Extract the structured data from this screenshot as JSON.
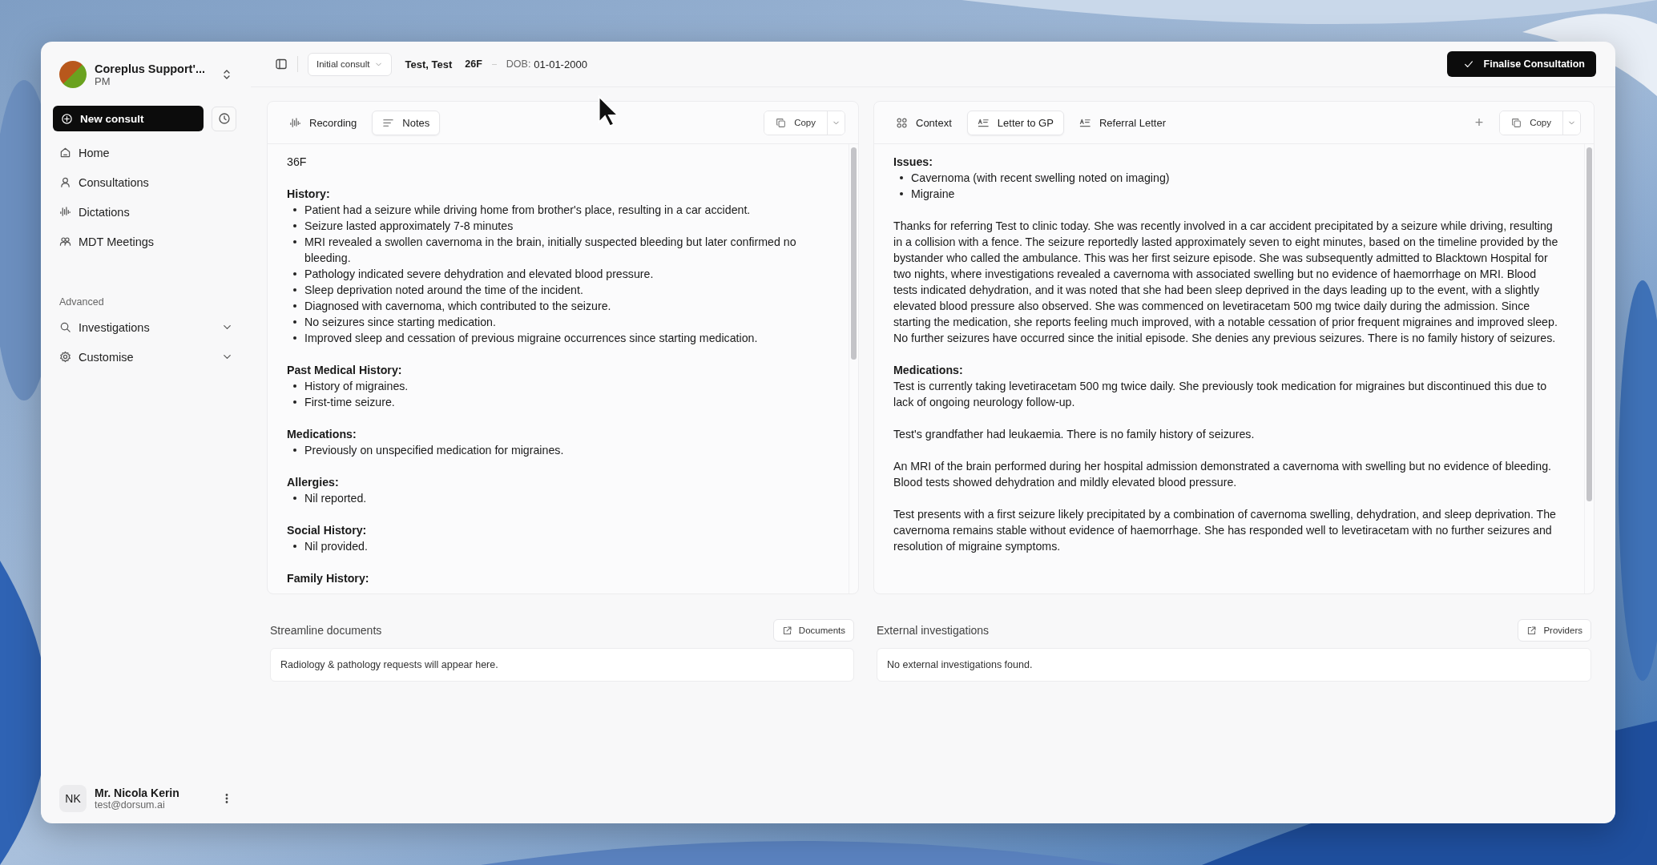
{
  "sidebar": {
    "org": {
      "name": "Coreplus Support'...",
      "role": "PM"
    },
    "new_consult": "New consult",
    "nav": [
      {
        "label": "Home"
      },
      {
        "label": "Consultations"
      },
      {
        "label": "Dictations"
      },
      {
        "label": "MDT Meetings"
      }
    ],
    "section_label": "Advanced",
    "advanced": [
      {
        "label": "Investigations",
        "expanded": false
      },
      {
        "label": "Customise",
        "expanded": false
      }
    ],
    "user": {
      "initials": "NK",
      "name": "Mr. Nicola Kerin",
      "email": "test@dorsum.ai"
    }
  },
  "header": {
    "visit_type": "Initial consult",
    "patient": "Test, Test",
    "age_sex": "26F",
    "dob_label": "DOB:",
    "dob": "01-01-2000",
    "action": "Finalise Consultation"
  },
  "panels": [
    {
      "tabs": [
        {
          "label": "Recording",
          "selected": false
        },
        {
          "label": "Notes",
          "selected": true
        }
      ],
      "copy": "Copy",
      "content": [
        {
          "kind": "text",
          "text": "36F"
        },
        {
          "kind": "heading",
          "text": "History:"
        },
        {
          "kind": "list",
          "items": [
            "Patient had a seizure while driving home from brother's place, resulting in a car accident.",
            "Seizure lasted approximately 7-8 minutes",
            "MRI revealed a swollen cavernoma in the brain, initially suspected bleeding but later confirmed no bleeding.",
            "Pathology indicated severe dehydration and elevated blood pressure.",
            "Sleep deprivation noted around the time of the incident.",
            "Diagnosed with cavernoma, which contributed to the seizure.",
            "No seizures since starting medication.",
            "Improved sleep and cessation of previous migraine occurrences since starting medication."
          ]
        },
        {
          "kind": "heading",
          "text": "Past Medical History:"
        },
        {
          "kind": "list",
          "items": [
            "History of migraines.",
            "First-time seizure."
          ]
        },
        {
          "kind": "heading",
          "text": "Medications:"
        },
        {
          "kind": "list",
          "items": [
            "Previously on unspecified medication for migraines."
          ]
        },
        {
          "kind": "heading",
          "text": "Allergies:"
        },
        {
          "kind": "list",
          "items": [
            "Nil reported."
          ]
        },
        {
          "kind": "heading",
          "text": "Social History:"
        },
        {
          "kind": "list",
          "items": [
            "Nil provided."
          ]
        },
        {
          "kind": "heading",
          "text": "Family History:"
        }
      ]
    },
    {
      "tabs": [
        {
          "label": "Context",
          "selected": false
        },
        {
          "label": "Letter to GP",
          "selected": true
        },
        {
          "label": "Referral Letter",
          "selected": false
        }
      ],
      "add": "+",
      "copy": "Copy",
      "content": [
        {
          "kind": "heading",
          "text": "Issues:"
        },
        {
          "kind": "list",
          "items": [
            "Cavernoma (with recent swelling noted on imaging)",
            "Migraine"
          ]
        },
        {
          "kind": "text",
          "text": "Thanks for referring Test to clinic today. She was recently involved in a car accident precipitated by a seizure while driving, resulting in a collision with a fence. The seizure reportedly lasted approximately seven to eight minutes, based on the timeline provided by the bystander who called the ambulance. This was her first seizure episode. She was subsequently admitted to Blacktown Hospital for two nights, where investigations revealed a cavernoma with associated swelling but no evidence of haemorrhage on MRI. Blood tests indicated dehydration, and it was noted that she had been sleep deprived in the days leading up to the event, with a slightly elevated blood pressure also observed. She was commenced on levetiracetam 500 mg twice daily during the admission. Since starting the medication, she reports feeling much improved, with a notable cessation of prior frequent migraines and improved sleep. No further seizures have occurred since the initial episode. She denies any previous seizures. There is no family history of seizures."
        },
        {
          "kind": "heading",
          "text": "Medications:"
        },
        {
          "kind": "text",
          "text": "Test is currently taking levetiracetam 500 mg twice daily. She previously took medication for migraines but discontinued this due to lack of ongoing neurology follow-up."
        },
        {
          "kind": "text",
          "text": "Test's grandfather had leukaemia. There is no family history of seizures."
        },
        {
          "kind": "text",
          "text": "An MRI of the brain performed during her hospital admission demonstrated a cavernoma with swelling but no evidence of bleeding. Blood tests showed dehydration and mildly elevated blood pressure."
        },
        {
          "kind": "text",
          "text": "Test presents with a first seizure likely precipitated by a combination of cavernoma swelling, dehydration, and sleep deprivation. The cavernoma remains stable without evidence of haemorrhage. She has responded well to levetiracetam with no further seizures and resolution of migraine symptoms."
        }
      ]
    }
  ],
  "bottom": [
    {
      "title": "Streamline documents",
      "button": "Documents",
      "message": "Radiology & pathology requests will appear here."
    },
    {
      "title": "External investigations",
      "button": "Providers",
      "message": "No external investigations found."
    }
  ]
}
